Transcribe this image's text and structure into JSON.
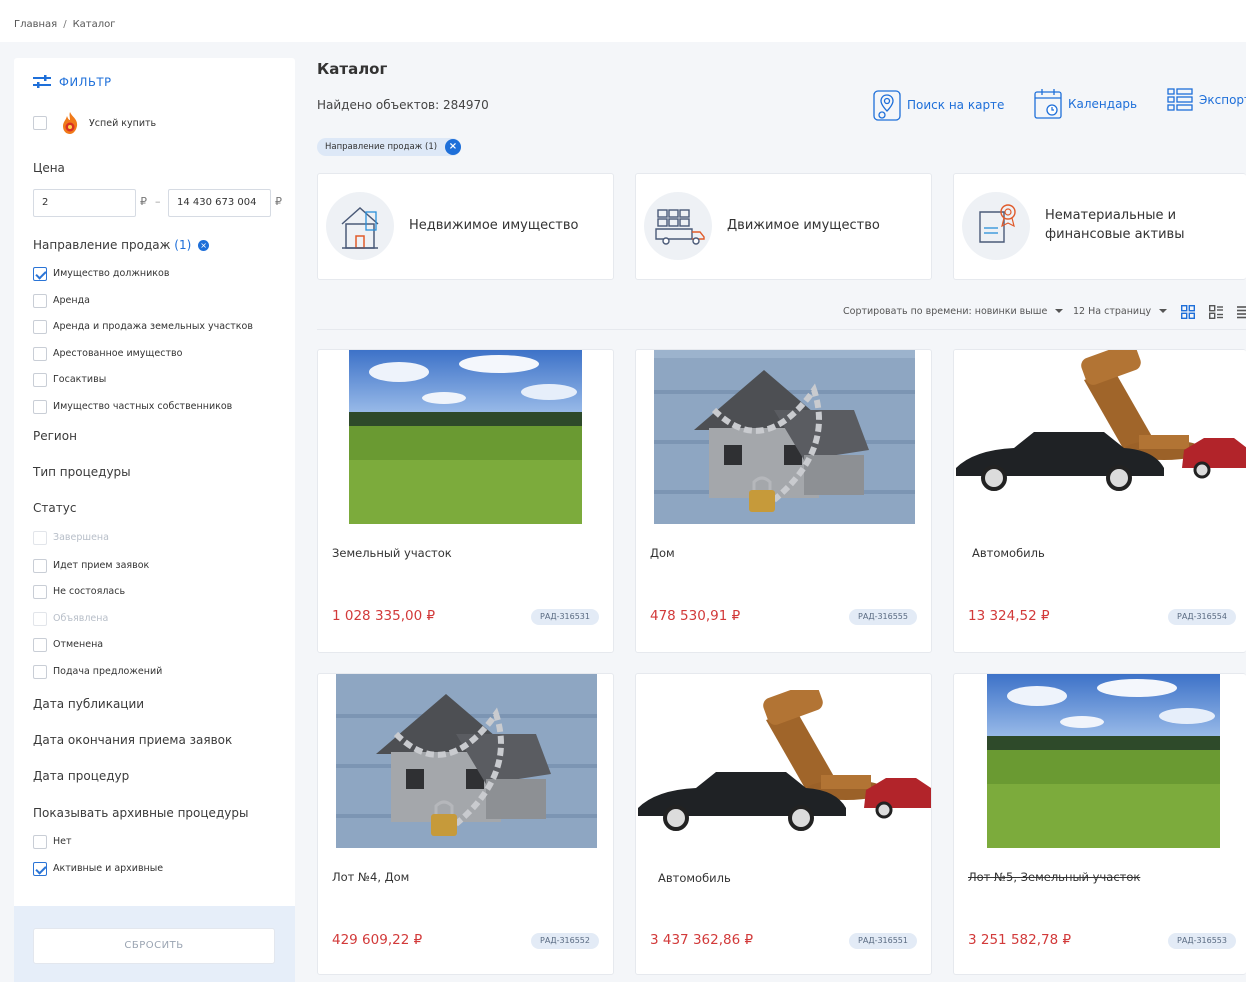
{
  "breadcrumb": {
    "home": "Главная",
    "separator": "/",
    "current": "Каталог"
  },
  "sidebar": {
    "filter_title": "ФИЛЬТР",
    "hurry_label": "Успей купить",
    "price_title": "Цена",
    "price_from": "2",
    "price_to": "14 430 673 004",
    "currency": "₽",
    "price_dash": "–",
    "direction_title": "Направление продаж",
    "direction_count": "(1)",
    "direction_items": [
      {
        "label": "Имущество должников",
        "checked": true
      },
      {
        "label": "Аренда",
        "checked": false
      },
      {
        "label": "Аренда и продажа земельных участков",
        "checked": false
      },
      {
        "label": "Арестованное имущество",
        "checked": false
      },
      {
        "label": "Госактивы",
        "checked": false
      },
      {
        "label": "Имущество частных собственников",
        "checked": false
      }
    ],
    "region_title": "Регион",
    "procedure_type_title": "Тип процедуры",
    "status_title": "Статус",
    "status_items": [
      {
        "label": "Завершена",
        "disabled": true
      },
      {
        "label": "Идет прием заявок",
        "disabled": false
      },
      {
        "label": "Не состоялась",
        "disabled": false
      },
      {
        "label": "Объявлена",
        "disabled": true
      },
      {
        "label": "Отменена",
        "disabled": false
      },
      {
        "label": "Подача предложений",
        "disabled": false
      }
    ],
    "pub_date_title": "Дата публикации",
    "end_date_title": "Дата окончания приема заявок",
    "proc_date_title": "Дата процедур",
    "archive_title": "Показывать архивные процедуры",
    "archive_items": [
      {
        "label": "Нет",
        "checked": false
      },
      {
        "label": "Активные и архивные",
        "checked": true
      }
    ],
    "reset_label": "СБРОСИТЬ"
  },
  "main": {
    "title": "Каталог",
    "found": "Найдено объектов: 284970",
    "links": {
      "map": "Поиск на карте",
      "calendar": "Календарь",
      "export": "Экспорт"
    },
    "chip": "Направление продаж (1)",
    "categories": [
      {
        "label_1": "Недвижимое имущество",
        "label_2": ""
      },
      {
        "label_1": "Движимое имущество",
        "label_2": ""
      },
      {
        "label_1": "Нематериальные и",
        "label_2": "финансовые активы"
      }
    ],
    "sort_label": "Сортировать по времени: новинки выше",
    "per_page_label": "12 На страницу",
    "cards": [
      {
        "title": "Земельный участок",
        "price": "1 028 335,00 ₽",
        "badge": "РАД-316531",
        "image": "field"
      },
      {
        "title": "Дом",
        "price": "478 530,91 ₽",
        "badge": "РАД-316555",
        "image": "house"
      },
      {
        "title": "Автомобиль",
        "price": "13 324,52 ₽",
        "badge": "РАД-316554",
        "image": "car"
      },
      {
        "title": "Лот №4,  Дом",
        "price": "429 609,22 ₽",
        "badge": "РАД-316552",
        "image": "house"
      },
      {
        "title": "Автомобиль",
        "price": "3 437 362,86 ₽",
        "badge": "РАД-316551",
        "image": "car"
      },
      {
        "title": "Лот №5, Земельный участок",
        "price": "3 251 582,78 ₽",
        "badge": "РАД-316553",
        "image": "field"
      }
    ]
  },
  "colors": {
    "accent": "#1e6fd9",
    "price": "#d23a3a",
    "badge_bg": "#e3ebf6"
  }
}
